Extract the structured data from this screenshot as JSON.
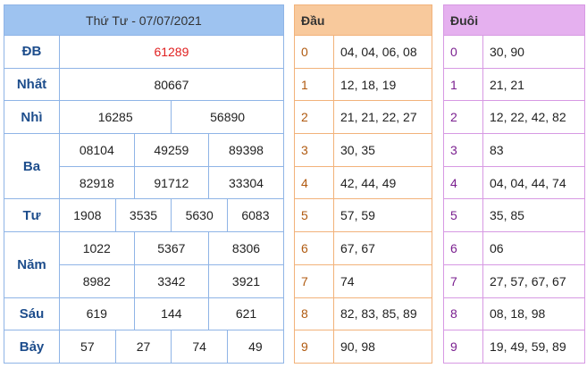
{
  "title": "Thứ Tư - 07/07/2021",
  "prizes": {
    "db": {
      "label": "ĐB",
      "values": [
        "61289"
      ]
    },
    "nhat": {
      "label": "Nhất",
      "values": [
        "80667"
      ]
    },
    "nhi": {
      "label": "Nhì",
      "values": [
        "16285",
        "56890"
      ]
    },
    "ba": {
      "label": "Ba",
      "values": [
        "08104",
        "49259",
        "89398",
        "82918",
        "91712",
        "33304"
      ]
    },
    "tu": {
      "label": "Tư",
      "values": [
        "1908",
        "3535",
        "5630",
        "6083"
      ]
    },
    "nam": {
      "label": "Năm",
      "values": [
        "1022",
        "5367",
        "8306",
        "8982",
        "3342",
        "3921"
      ]
    },
    "sau": {
      "label": "Sáu",
      "values": [
        "619",
        "144",
        "621"
      ]
    },
    "bay": {
      "label": "Bảy",
      "values": [
        "57",
        "27",
        "74",
        "49"
      ]
    }
  },
  "head": {
    "header": "Đầu",
    "rows": [
      {
        "digit": "0",
        "values": "04, 04, 06, 08"
      },
      {
        "digit": "1",
        "values": "12, 18, 19"
      },
      {
        "digit": "2",
        "values": "21, 21, 22, 27"
      },
      {
        "digit": "3",
        "values": "30, 35"
      },
      {
        "digit": "4",
        "values": "42, 44, 49"
      },
      {
        "digit": "5",
        "values": "57, 59"
      },
      {
        "digit": "6",
        "values": "67, 67"
      },
      {
        "digit": "7",
        "values": "74"
      },
      {
        "digit": "8",
        "values": "82, 83, 85, 89"
      },
      {
        "digit": "9",
        "values": "90, 98"
      }
    ]
  },
  "tail": {
    "header": "Đuôi",
    "rows": [
      {
        "digit": "0",
        "values": "30, 90"
      },
      {
        "digit": "1",
        "values": "21, 21"
      },
      {
        "digit": "2",
        "values": "12, 22, 42, 82"
      },
      {
        "digit": "3",
        "values": "83"
      },
      {
        "digit": "4",
        "values": "04, 04, 44, 74"
      },
      {
        "digit": "5",
        "values": "35, 85"
      },
      {
        "digit": "6",
        "values": "06"
      },
      {
        "digit": "7",
        "values": "27, 57, 67, 67"
      },
      {
        "digit": "8",
        "values": "08, 18, 98"
      },
      {
        "digit": "9",
        "values": "19, 49, 59, 89"
      }
    ]
  },
  "colors": {
    "result_header": "#9ec3f0",
    "head_header": "#f8c99c",
    "tail_header": "#e5b0ef",
    "special_prize": "#e02020",
    "label": "#1d4d8c"
  }
}
